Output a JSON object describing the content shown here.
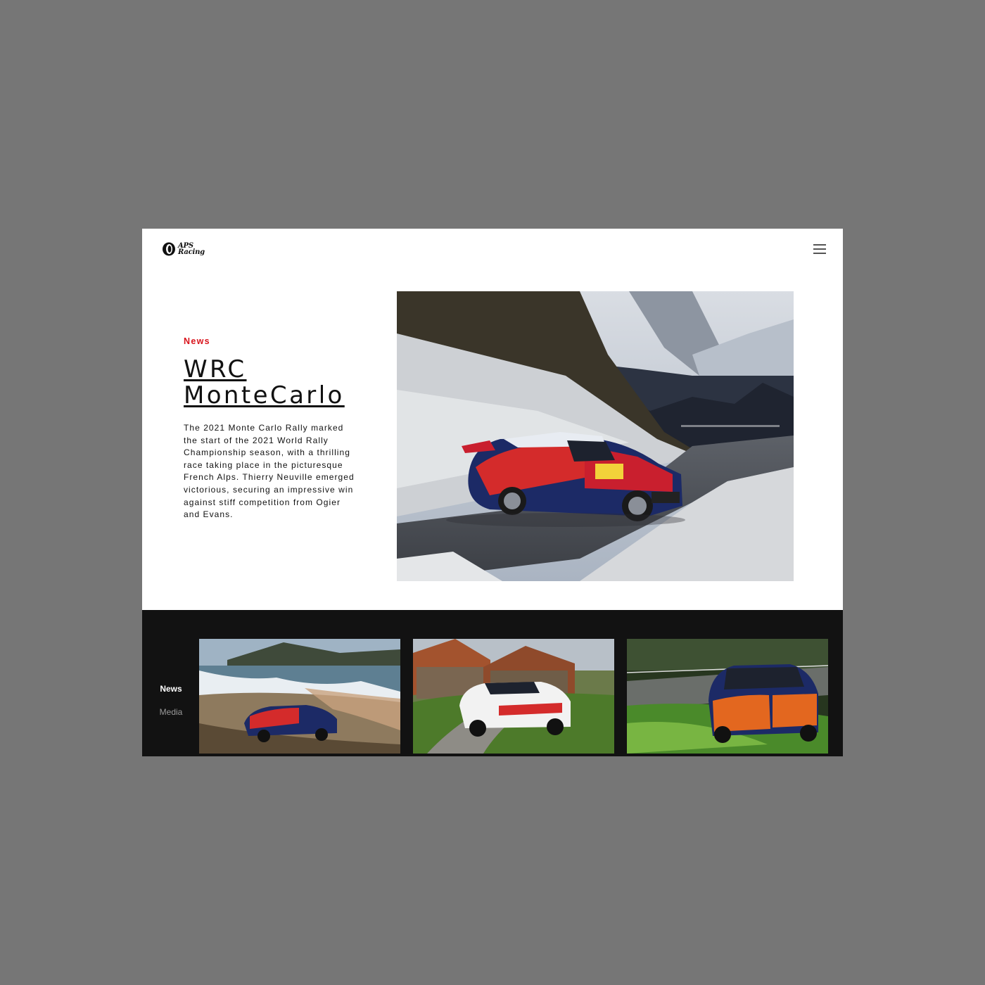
{
  "brand": {
    "name_line1": "APS",
    "name_line2": "Racing"
  },
  "header": {
    "menu_icon": "hamburger-menu-icon"
  },
  "hero": {
    "category": "News",
    "title_line1": "WRC",
    "title_line2": "MonteCarlo",
    "description": "The 2021 Monte Carlo Rally marked the start of the 2021 World Rally Championship season, with a thrilling race taking place in the picturesque French Alps. Thierry Neuville emerged victorious, securing an impressive win against stiff competition from Ogier and Evans.",
    "image": "rally-car-snowy-mountain-road"
  },
  "bottom": {
    "nav": [
      {
        "label": "News",
        "active": true
      },
      {
        "label": "Media",
        "active": false
      }
    ],
    "thumbnails": [
      {
        "image": "rally-car-coastal-gravel"
      },
      {
        "image": "rally-car-village-road"
      },
      {
        "image": "rally-car-tarmac-grass"
      }
    ]
  },
  "colors": {
    "accent": "#d9141c",
    "page_background": "#767676",
    "dark_band": "#121212",
    "text": "#111111"
  }
}
